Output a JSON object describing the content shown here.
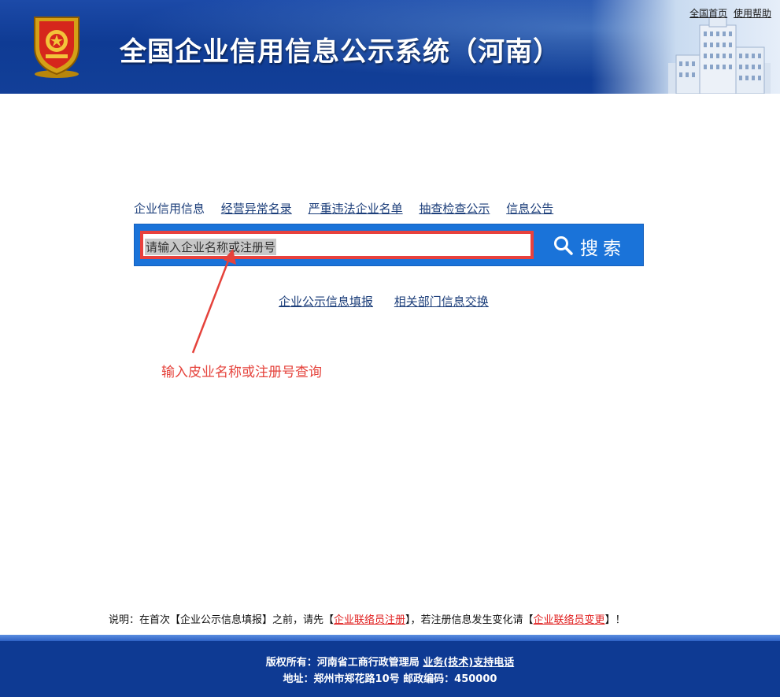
{
  "header": {
    "title": "全国企业信用信息公示系统（河南）",
    "top_links": [
      "全国首页",
      "使用帮助"
    ]
  },
  "nav": {
    "items": [
      "企业信用信息",
      "经营异常名录",
      "严重违法企业名单",
      "抽查检查公示",
      "信息公告"
    ]
  },
  "search": {
    "placeholder": "请输入企业名称或注册号",
    "button_label": "搜索"
  },
  "sub_links": [
    "企业公示信息填报",
    "相关部门信息交换"
  ],
  "annotation": "输入皮业名称或注册号查询",
  "note": {
    "prefix": "说明：在首次【企业公示信息填报】之前，请先【",
    "link1": "企业联络员注册",
    "middle": "】，若注册信息发生变化请【",
    "link2": "企业联络员变更",
    "suffix": "】！"
  },
  "footer": {
    "line1_prefix": "版权所有：河南省工商行政管理局 ",
    "line1_link": "业务(技术)支持电话",
    "line2": "地址：郑州市郑花路10号  邮政编码：450000"
  },
  "colors": {
    "header_blue": "#0f3b94",
    "search_blue": "#1a73d9",
    "highlight_red": "#e8413d",
    "link_blue": "#1c3e7a"
  }
}
